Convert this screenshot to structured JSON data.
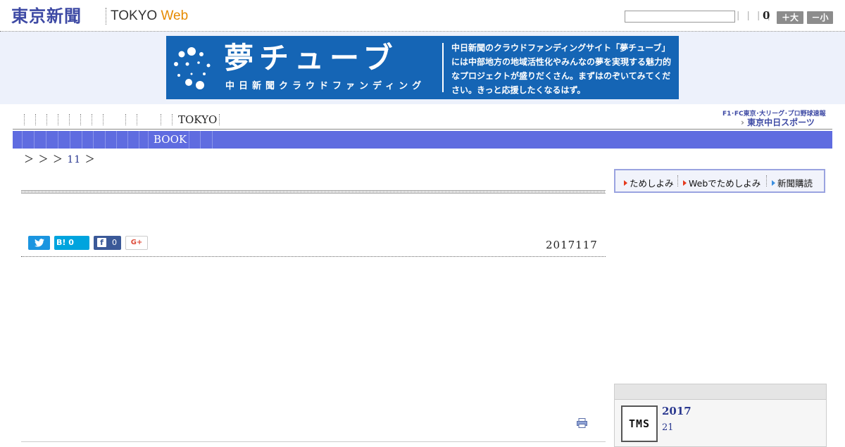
{
  "header": {
    "logo_main": "東京新聞",
    "logo_sub_tokyo": "TOKYO",
    "logo_sub_web": "Web",
    "search_placeholder": "",
    "header_links": "| | | |",
    "count": "0",
    "font_bigger": "＋大",
    "font_smaller": "－小"
  },
  "banner": {
    "title": "夢チューブ",
    "subtitle": "中日新聞クラウドファンディング",
    "text": "中日新聞のクラウドファンディングサイト「夢チューブ」には中部地方の地域活性化やみんなの夢を実現する魅力的なプロジェクトが盛りだくさん。まずはのぞいてみてください。きっと応援したくなるはず。",
    "bg_color": "#1565b5"
  },
  "nav1": {
    "tokyo_label": "TOKYO",
    "partner_tagline": "F1･FC東京･大リーグ･プロ野球速報",
    "partner_logo": "東京中日スポーツ"
  },
  "nav2": {
    "book_label": "BOOK",
    "bar_color": "#5f6ce0"
  },
  "breadcrumb": {
    "prefix": "＞ ＞ ＞",
    "link": "11",
    "suffix": "＞"
  },
  "share": {
    "twitter_icon": "twitter-icon",
    "hatena_label": "B! 0",
    "facebook_count": "0",
    "googleplus_label": "G+"
  },
  "article": {
    "date": "2017117"
  },
  "sidebar": {
    "trial_links": [
      "ためしよみ",
      "Webでためしよみ",
      "新聞購読"
    ],
    "box_thumb": "TMS",
    "box_year": "2017",
    "box_num": "21"
  }
}
